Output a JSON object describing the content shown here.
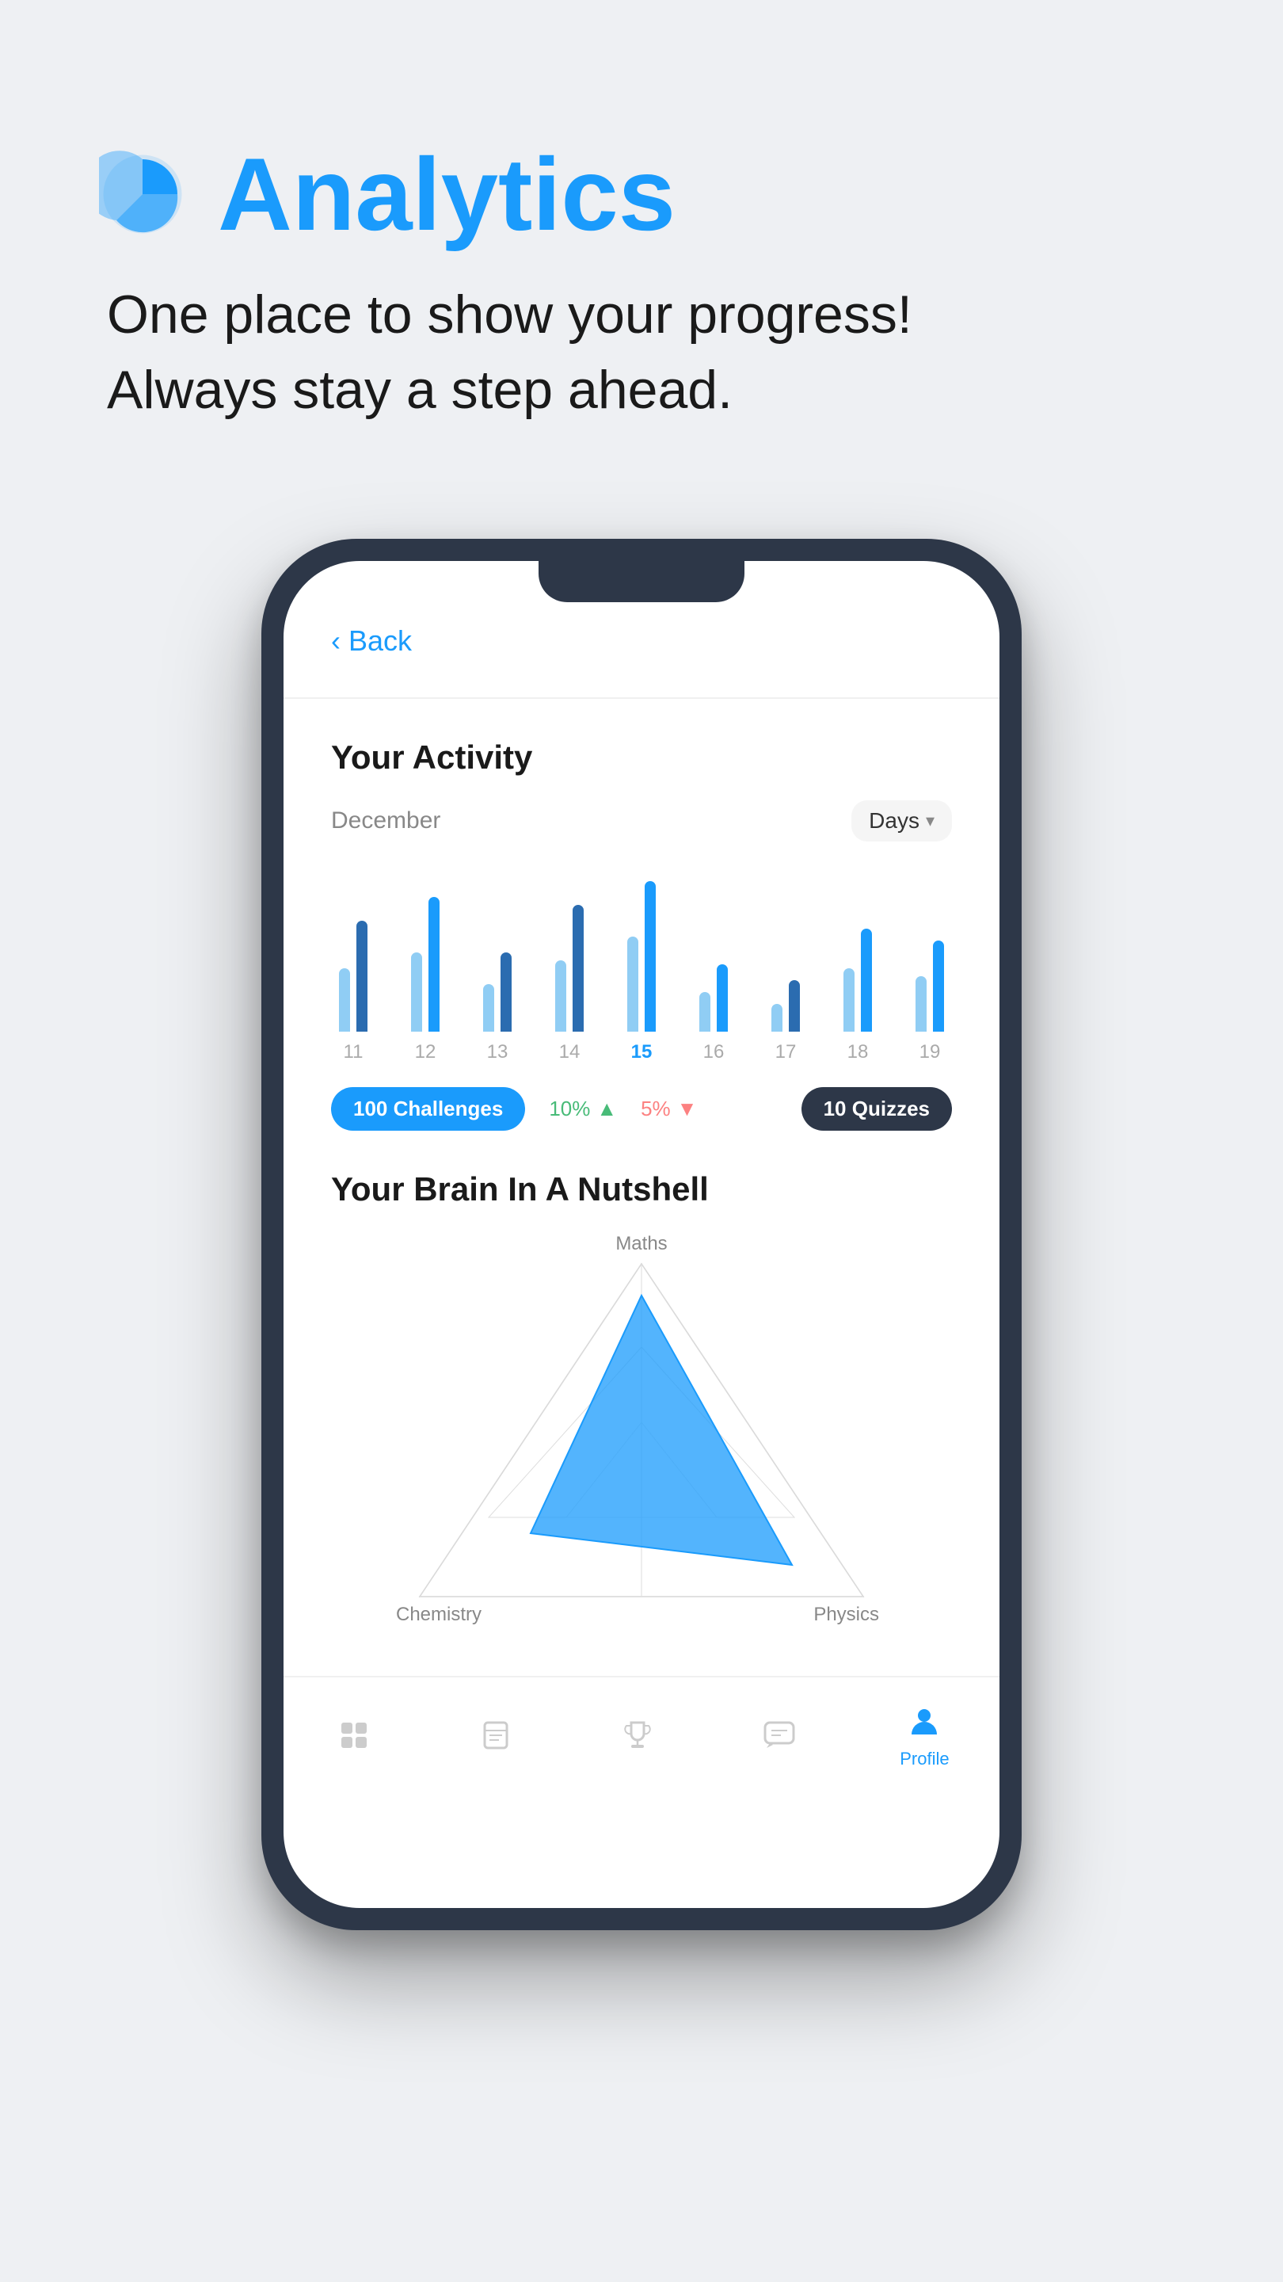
{
  "page": {
    "background": "#eef0f3"
  },
  "header": {
    "icon_alt": "analytics-pie-icon",
    "title": "Analytics",
    "subtitle_line1": "One place to show your progress!",
    "subtitle_line2": "Always stay a step ahead."
  },
  "phone": {
    "back_label": "Back",
    "screen": {
      "activity_section": {
        "title": "Your Activity",
        "month": "December",
        "filter_label": "Days",
        "days": [
          11,
          12,
          13,
          14,
          15,
          16,
          17,
          18,
          19
        ],
        "active_day": 15,
        "bars": [
          {
            "day": 11,
            "heights": [
              80,
              140
            ]
          },
          {
            "day": 12,
            "heights": [
              120,
              170
            ]
          },
          {
            "day": 13,
            "heights": [
              60,
              100
            ]
          },
          {
            "day": 14,
            "heights": [
              100,
              160
            ]
          },
          {
            "day": 15,
            "heights": [
              140,
              190
            ]
          },
          {
            "day": 16,
            "heights": [
              60,
              90
            ]
          },
          {
            "day": 17,
            "heights": [
              50,
              80
            ]
          },
          {
            "day": 18,
            "heights": [
              90,
              130
            ]
          },
          {
            "day": 19,
            "heights": [
              80,
              120
            ]
          }
        ],
        "badges": {
          "challenges": "100 Challenges",
          "pct_positive": "10%",
          "pct_negative": "5%",
          "quizzes": "10 Quizzes"
        }
      },
      "brain_section": {
        "title": "Your Brain In A Nutshell",
        "labels": {
          "top": "Maths",
          "bottom_left": "Chemistry",
          "bottom_right": "Physics"
        }
      },
      "bottom_nav": {
        "items": [
          {
            "name": "home",
            "label": "",
            "active": false
          },
          {
            "name": "learn",
            "label": "",
            "active": false
          },
          {
            "name": "trophy",
            "label": "",
            "active": false
          },
          {
            "name": "chat",
            "label": "",
            "active": false
          },
          {
            "name": "profile",
            "label": "Profile",
            "active": true
          }
        ]
      }
    }
  }
}
